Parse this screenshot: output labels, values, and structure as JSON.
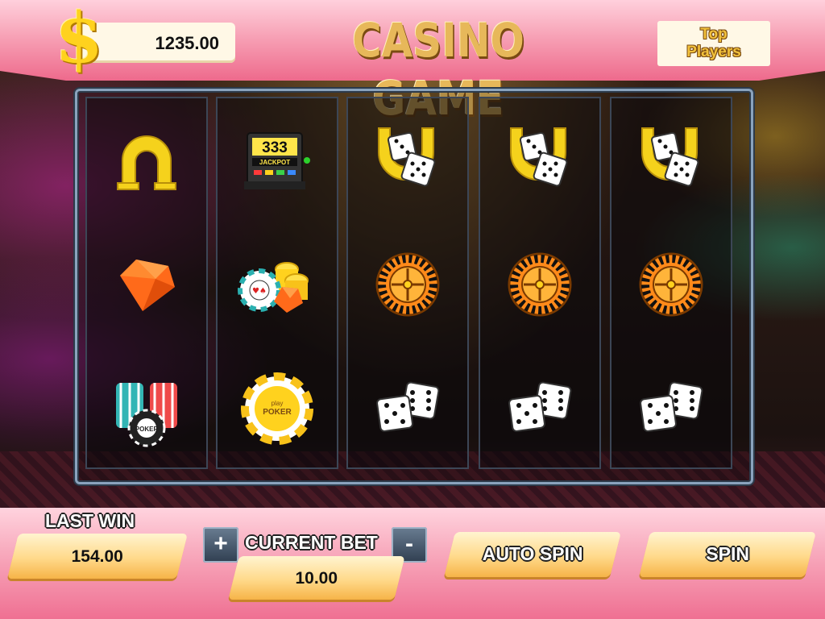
{
  "header": {
    "currency_symbol": "$",
    "balance": "1235.00",
    "title": "CASINO GAME",
    "top_players_line1": "Top",
    "top_players_line2": "Players"
  },
  "reels": [
    [
      "horseshoe-icon",
      "gem-icon",
      "chip-stacks-icon"
    ],
    [
      "jackpot-slot-machine-icon",
      "chips-and-gem-icon",
      "poker-chip-icon"
    ],
    [
      "horseshoe-dice-icon",
      "roulette-wheel-icon",
      "dice-pair-icon"
    ],
    [
      "horseshoe-dice-icon",
      "roulette-wheel-icon",
      "dice-pair-icon"
    ],
    [
      "horseshoe-dice-icon",
      "roulette-wheel-icon",
      "dice-pair-icon"
    ]
  ],
  "symbol_text": {
    "jackpot_digits": "333",
    "jackpot_label": "JACKPOT",
    "poker_chip_line1": "play",
    "poker_chip_line2": "POKER"
  },
  "footer": {
    "last_win_label": "LAST WIN",
    "last_win_value": "154.00",
    "increase_bet_label": "+",
    "current_bet_label": "CURRENT BET",
    "current_bet_value": "10.00",
    "decrease_bet_label": "-",
    "auto_spin_label": "AUTO SPIN",
    "spin_label": "SPIN"
  },
  "colors": {
    "gold": "#ffd21e",
    "pink": "#ef7092",
    "panel": "#ffd98a",
    "orange_gem": "#ff6a1a"
  }
}
